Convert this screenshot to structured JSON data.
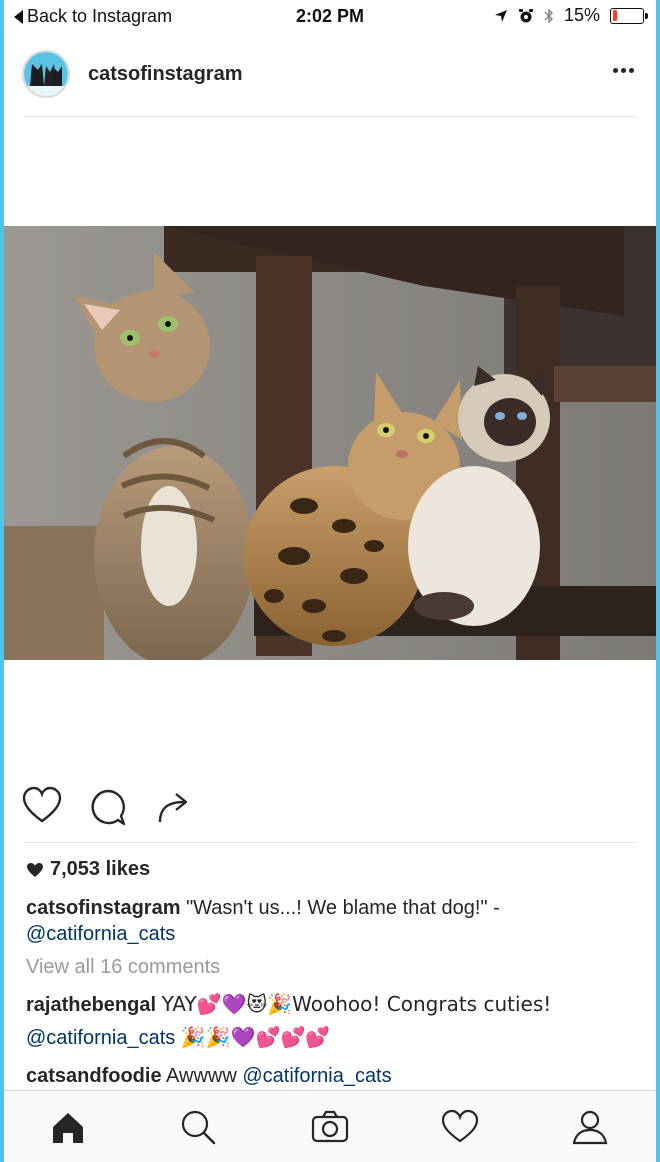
{
  "status_bar": {
    "back_label": "Back to Instagram",
    "time": "2:02 PM",
    "battery_text": "15%",
    "battery_level": 0.15,
    "battery_color": "#ff3b30"
  },
  "post": {
    "username": "catsofinstagram",
    "avatar_icon": "cat-avatar-icon",
    "photo_icon": "cats-photo",
    "likes": "7,053 likes",
    "caption_user": "catsofinstagram",
    "caption_text": "\"Wasn't us...! We blame that dog!\" -",
    "caption_mention": "@catifornia_cats",
    "view_all_comments": "View all 16 comments",
    "comments": [
      {
        "user": "rajathebengal",
        "line1": "YAY💕💜😻🎉Woohoo! Congrats cuties!",
        "mention": "@catifornia_cats",
        "line2_tail": "🎉🎉💜💕💕💕"
      },
      {
        "user": "catsandfoodie",
        "text": "Awwww",
        "mention": "@catifornia_cats"
      }
    ]
  },
  "actions": {
    "like_icon": "heart-icon",
    "comment_icon": "comment-icon",
    "share_icon": "share-icon"
  },
  "tab_bar": {
    "items": [
      "home-icon",
      "search-icon",
      "camera-icon",
      "heart-icon",
      "profile-icon"
    ]
  },
  "colors": {
    "frame_accent": "#4fc3e8",
    "mention": "#003569",
    "muted": "#999999"
  }
}
